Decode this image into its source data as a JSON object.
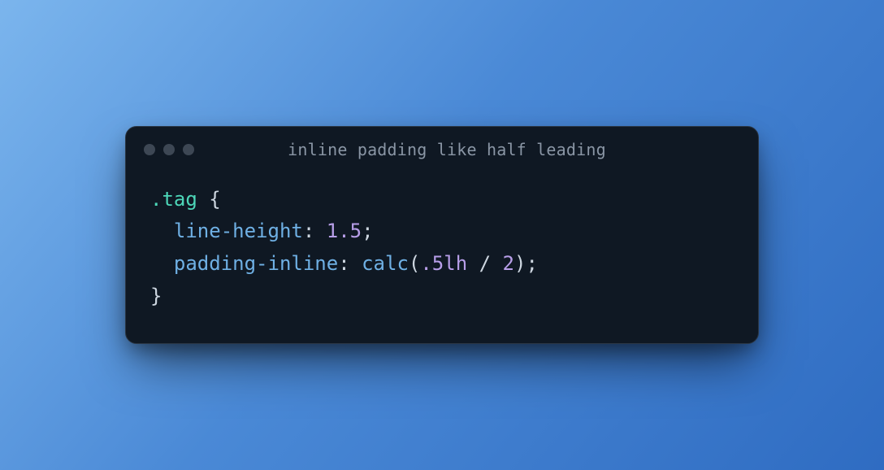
{
  "window": {
    "title": "inline padding like half leading"
  },
  "code": {
    "selector": ".tag",
    "brace_open": "{",
    "brace_close": "}",
    "line1": {
      "prop": "line-height",
      "colon": ":",
      "value": "1.5",
      "semi": ";"
    },
    "line2": {
      "prop": "padding-inline",
      "colon": ":",
      "func": "calc",
      "paren_open": "(",
      "val": ".5",
      "unit": "lh",
      "op": "/",
      "val2": "2",
      "paren_close": ")",
      "semi": ";"
    }
  }
}
